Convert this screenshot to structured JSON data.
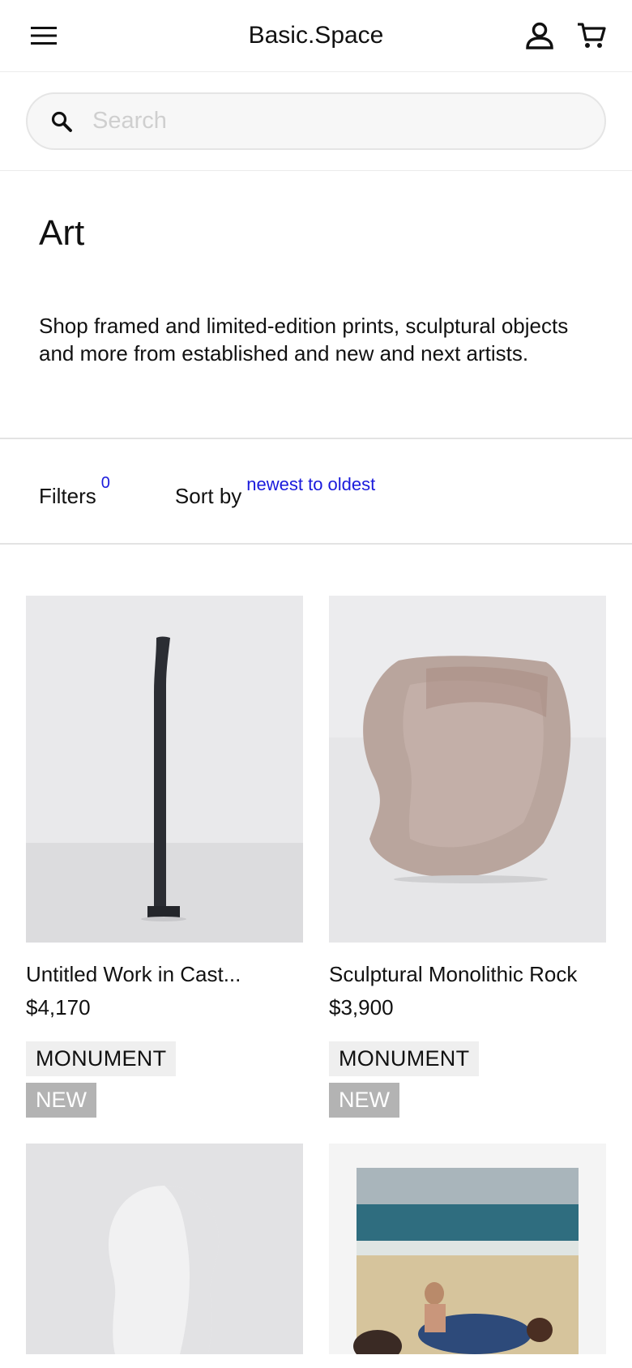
{
  "header": {
    "brand": "Basic.Space",
    "menu_icon": "hamburger-menu-icon",
    "account_icon": "user-icon",
    "cart_icon": "shopping-cart-icon"
  },
  "search": {
    "placeholder": "Search",
    "icon": "search-icon"
  },
  "page": {
    "title": "Art",
    "description": "Shop framed and limited-edition prints, sculptural objects and more from established and new and next artists."
  },
  "controls": {
    "filters_label": "Filters",
    "filters_count": "0",
    "sort_label": "Sort by",
    "sort_value": "newest to oldest"
  },
  "colors": {
    "accent": "#1a1adc",
    "tag_monument_bg": "#efefef",
    "tag_new_bg": "#b3b3b3"
  },
  "products": [
    {
      "title": "Untitled Work in Cast...",
      "price": "$4,170",
      "tag": "MONUMENT",
      "badge": "NEW"
    },
    {
      "title": "Sculptural Monolithic Rock",
      "price": "$3,900",
      "tag": "MONUMENT",
      "badge": "NEW"
    },
    {},
    {}
  ]
}
